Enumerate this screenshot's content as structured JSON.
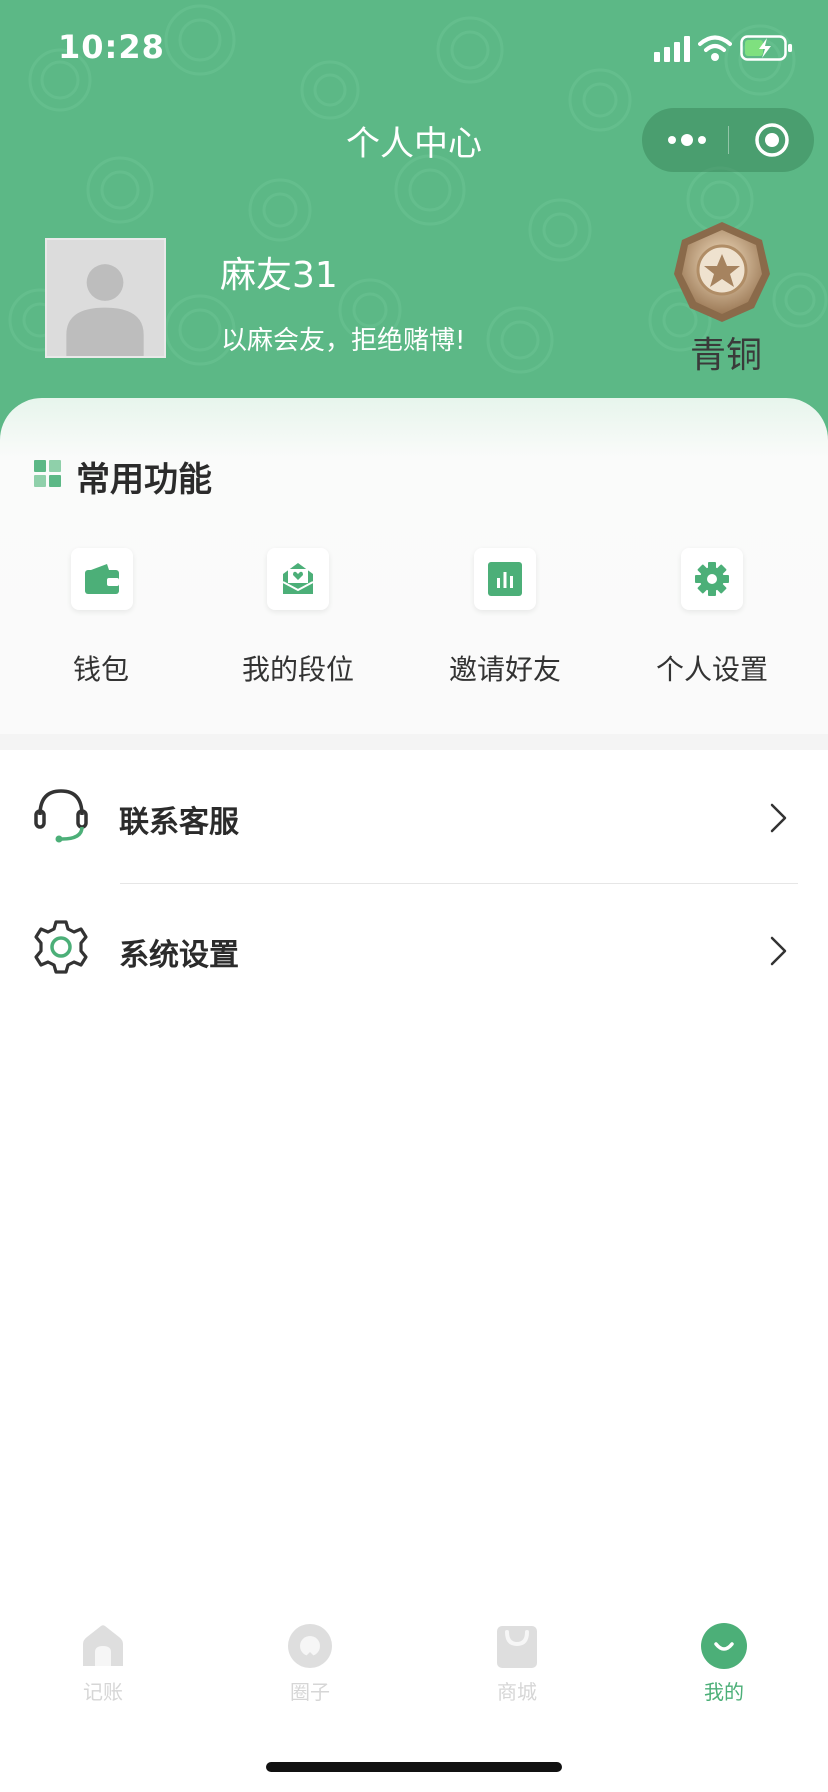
{
  "status_bar": {
    "time": "10:28"
  },
  "nav": {
    "title": "个人中心"
  },
  "profile": {
    "username": "麻友31",
    "motto": "以麻会友，拒绝赌博!",
    "rank": "青铜"
  },
  "common_functions": {
    "title": "常用功能",
    "items": [
      {
        "label": "钱包",
        "icon": "wallet-icon"
      },
      {
        "label": "我的段位",
        "icon": "rank-mail-icon"
      },
      {
        "label": "邀请好友",
        "icon": "bar-chart-icon"
      },
      {
        "label": "个人设置",
        "icon": "gear-icon"
      }
    ]
  },
  "menu": {
    "items": [
      {
        "label": "联系客服",
        "icon": "headset-icon"
      },
      {
        "label": "系统设置",
        "icon": "settings-icon"
      }
    ]
  },
  "tab_bar": {
    "items": [
      {
        "label": "记账",
        "icon": "home-icon",
        "active": false
      },
      {
        "label": "圈子",
        "icon": "circle-icon",
        "active": false
      },
      {
        "label": "商城",
        "icon": "shopping-bag-icon",
        "active": false
      },
      {
        "label": "我的",
        "icon": "smile-icon",
        "active": true
      }
    ]
  },
  "colors": {
    "header_green": "#5cb886",
    "accent_green": "#4caf78",
    "tab_inactive": "#d6d6d6"
  }
}
